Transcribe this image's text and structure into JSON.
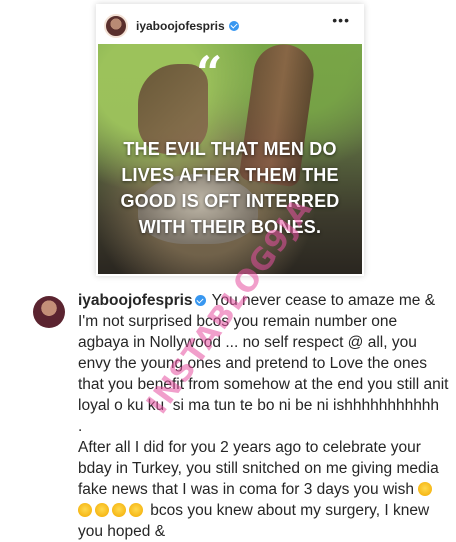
{
  "post": {
    "username": "iyaboojofespris",
    "quote_mark": "“",
    "quote_lines": [
      "THE EVIL THAT MEN DO",
      "LIVES AFTER THEM THE",
      "GOOD IS OFT INTERRED",
      "WITH THEIR BONES."
    ],
    "more_icon": "•••"
  },
  "comment": {
    "username": "iyaboojofespris",
    "text_part1": " You never cease to amaze me & I'm not surprised bcos you remain number one agbaya in Nollywood ... no self respect @ all, you envy the young ones and pretend to Love the ones that you benefit from somehow at the end you still anit loyal o ku ku  si ma tun te bo ni be ni ishhhhhhhhhhh\n.\nAfter all I did for you 2 years ago to celebrate your bday in Turkey, you still snitched on me giving media fake news that I was in coma for 3 days you wish ",
    "text_part2": " bcos you knew about my surgery, I knew you hoped &"
  },
  "watermark": "INSTABLOG9JA",
  "colors": {
    "accent": "#3897f0",
    "text": "#262626",
    "watermark": "#e650a0"
  }
}
